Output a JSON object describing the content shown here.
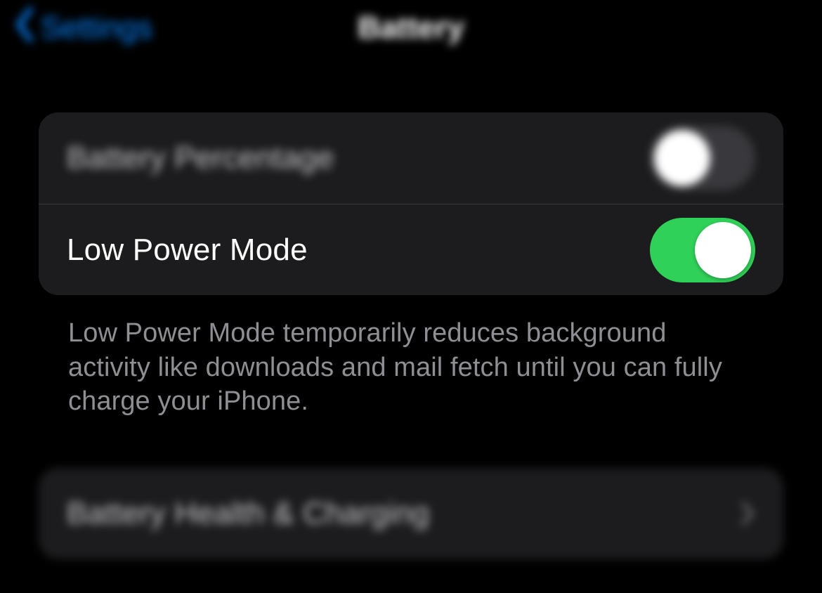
{
  "nav": {
    "back_label": "Settings",
    "title": "Battery"
  },
  "group1": {
    "battery_percentage": {
      "label": "Battery Percentage",
      "on": false
    },
    "low_power_mode": {
      "label": "Low Power Mode",
      "on": true
    },
    "footer": "Low Power Mode temporarily reduces background activity like downloads and mail fetch until you can fully charge your iPhone."
  },
  "group2": {
    "battery_health": {
      "label": "Battery Health & Charging"
    }
  },
  "colors": {
    "accent": "#0a84ff",
    "toggle_on": "#30d158",
    "toggle_off": "#39393d",
    "cell_bg": "#1c1c1e"
  }
}
